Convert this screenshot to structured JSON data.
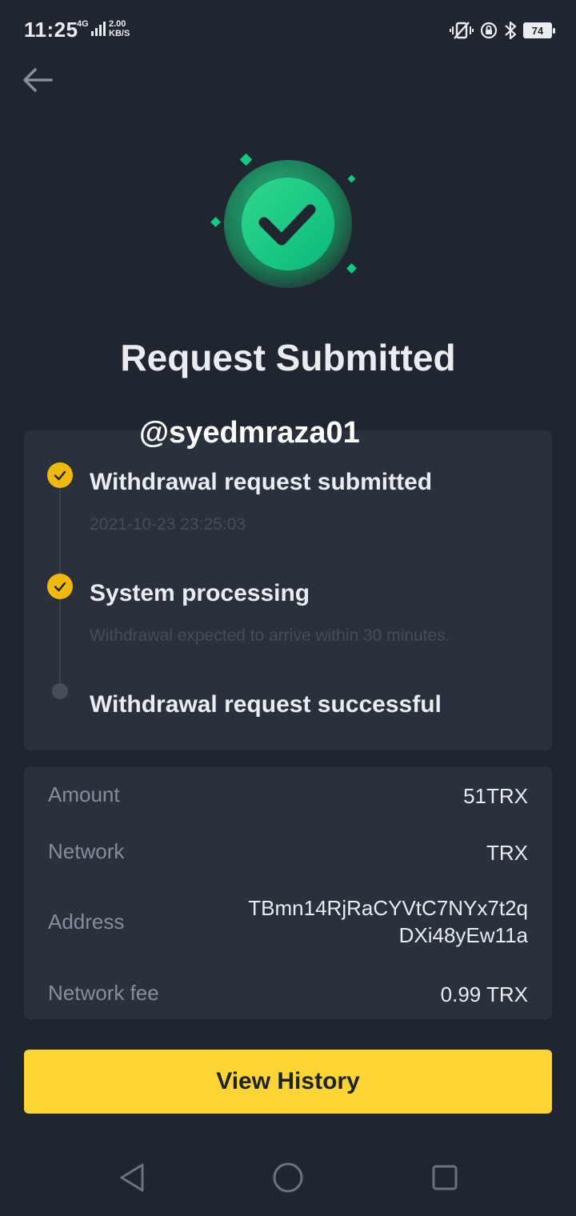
{
  "status_bar": {
    "time": "11:25",
    "network_type": "4G",
    "speed_value": "2.00",
    "speed_unit": "KB/S",
    "battery_level": "74"
  },
  "header": {
    "back_icon": "arrow-left-icon"
  },
  "hero": {
    "icon": "success-check-icon",
    "accent_color": "#0ecb81",
    "title": "Request Submitted"
  },
  "watermark": "@syedmraza01",
  "timeline": {
    "steps": [
      {
        "title": "Withdrawal request submitted",
        "subtitle": "2021-10-23 23:25:03",
        "state": "done"
      },
      {
        "title": "System processing",
        "subtitle": "Withdrawal expected to arrive within 30 minutes.",
        "state": "done"
      },
      {
        "title": "Withdrawal request successful",
        "subtitle": "",
        "state": "pending"
      }
    ],
    "done_color": "#f0b90b"
  },
  "details": {
    "amount_label": "Amount",
    "amount_value": "51TRX",
    "network_label": "Network",
    "network_value": "TRX",
    "address_label": "Address",
    "address_line1": "TBmn14RjRaCYVtC7NYx7t2q",
    "address_line2": "DXi48yEw11a",
    "fee_label": "Network fee",
    "fee_value": "0.99 TRX"
  },
  "actions": {
    "view_history_label": "View History",
    "button_color": "#fcd535"
  },
  "nav": {
    "back": "triangle-back-icon",
    "home": "circle-home-icon",
    "recents": "square-recents-icon"
  }
}
